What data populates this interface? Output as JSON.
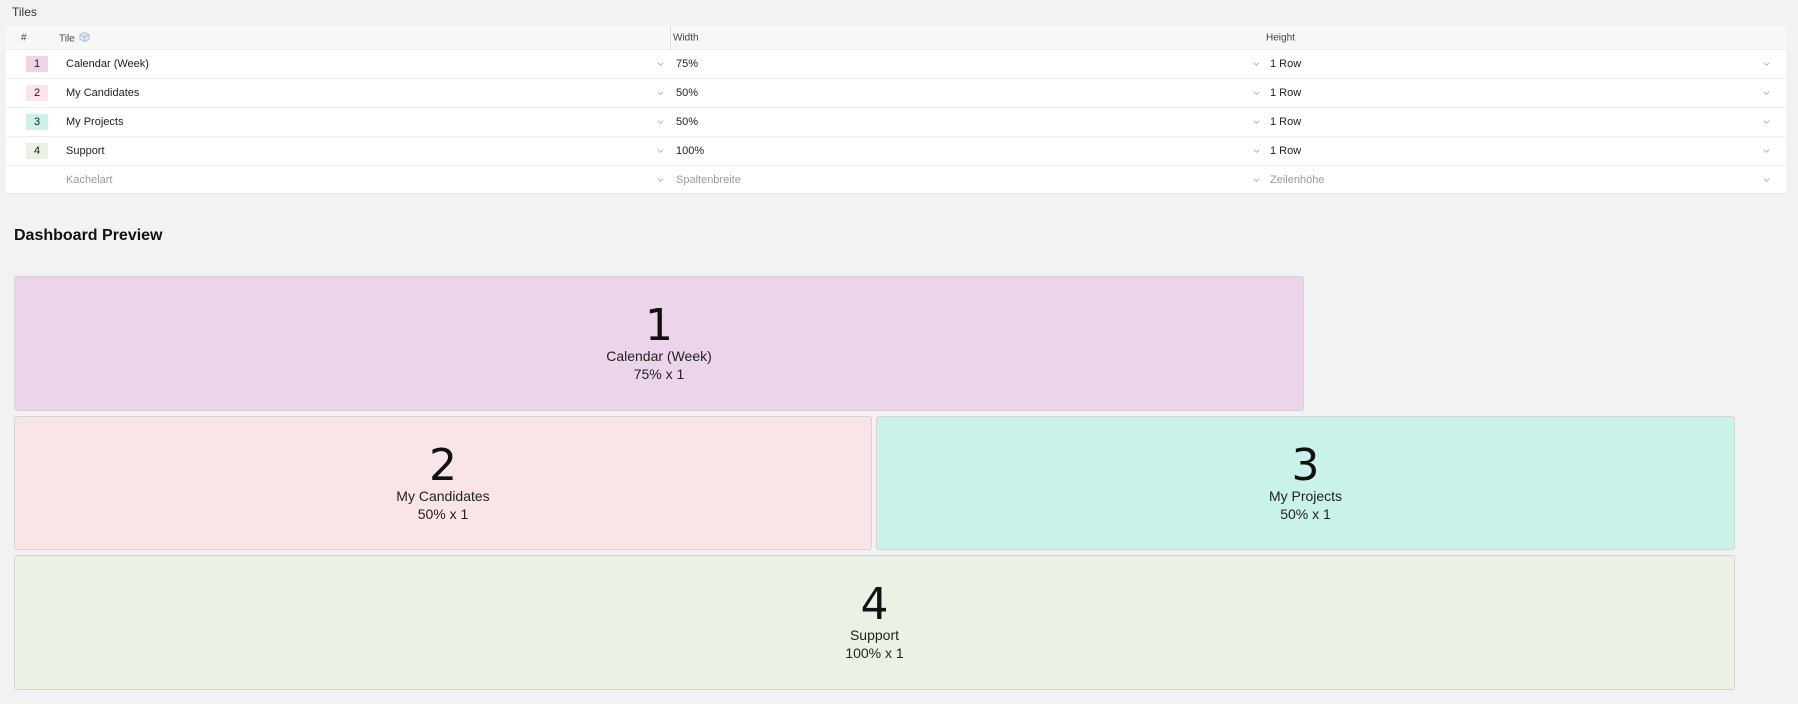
{
  "tiles_section": {
    "label": "Tiles",
    "headers": {
      "num": "#",
      "tile": "Tile",
      "width": "Width",
      "height": "Height"
    },
    "rows": [
      {
        "num": "1",
        "tile": "Calendar (Week)",
        "width": "75%",
        "height": "1 Row",
        "color": "#ecd4ea"
      },
      {
        "num": "2",
        "tile": "My Candidates",
        "width": "50%",
        "height": "1 Row",
        "color": "#f9e4e8"
      },
      {
        "num": "3",
        "tile": "My Projects",
        "width": "50%",
        "height": "1 Row",
        "color": "#c9f3ea"
      },
      {
        "num": "4",
        "tile": "Support",
        "width": "100%",
        "height": "1 Row",
        "color": "#eaf2e6"
      }
    ],
    "placeholders": {
      "tile": "Kachelart",
      "width": "Spaltenbreite",
      "height": "Zeilenhöhe"
    }
  },
  "preview": {
    "title": "Dashboard Preview",
    "tiles": [
      {
        "num": "1",
        "name": "Calendar (Week)",
        "size": "75% x 1",
        "color": "#ecd4ea"
      },
      {
        "num": "2",
        "name": "My Candidates",
        "size": "50% x 1",
        "color": "#f9e4e8"
      },
      {
        "num": "3",
        "name": "My Projects",
        "size": "50% x 1",
        "color": "#c9f3ea"
      },
      {
        "num": "4",
        "name": "Support",
        "size": "100% x 1",
        "color": "#eaf2e6"
      }
    ]
  }
}
